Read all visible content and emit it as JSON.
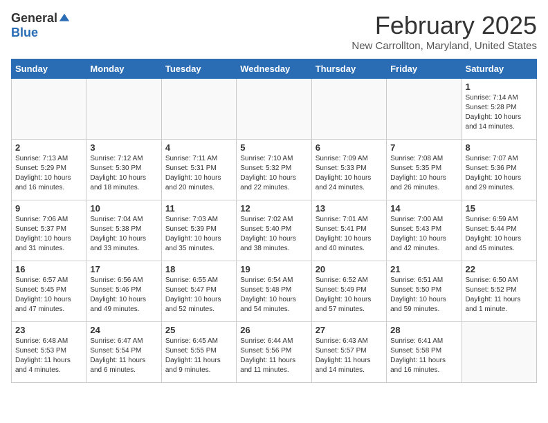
{
  "header": {
    "logo_general": "General",
    "logo_blue": "Blue",
    "month_title": "February 2025",
    "location": "New Carrollton, Maryland, United States"
  },
  "days_of_week": [
    "Sunday",
    "Monday",
    "Tuesday",
    "Wednesday",
    "Thursday",
    "Friday",
    "Saturday"
  ],
  "weeks": [
    [
      {
        "day": "",
        "info": ""
      },
      {
        "day": "",
        "info": ""
      },
      {
        "day": "",
        "info": ""
      },
      {
        "day": "",
        "info": ""
      },
      {
        "day": "",
        "info": ""
      },
      {
        "day": "",
        "info": ""
      },
      {
        "day": "1",
        "info": "Sunrise: 7:14 AM\nSunset: 5:28 PM\nDaylight: 10 hours and 14 minutes."
      }
    ],
    [
      {
        "day": "2",
        "info": "Sunrise: 7:13 AM\nSunset: 5:29 PM\nDaylight: 10 hours and 16 minutes."
      },
      {
        "day": "3",
        "info": "Sunrise: 7:12 AM\nSunset: 5:30 PM\nDaylight: 10 hours and 18 minutes."
      },
      {
        "day": "4",
        "info": "Sunrise: 7:11 AM\nSunset: 5:31 PM\nDaylight: 10 hours and 20 minutes."
      },
      {
        "day": "5",
        "info": "Sunrise: 7:10 AM\nSunset: 5:32 PM\nDaylight: 10 hours and 22 minutes."
      },
      {
        "day": "6",
        "info": "Sunrise: 7:09 AM\nSunset: 5:33 PM\nDaylight: 10 hours and 24 minutes."
      },
      {
        "day": "7",
        "info": "Sunrise: 7:08 AM\nSunset: 5:35 PM\nDaylight: 10 hours and 26 minutes."
      },
      {
        "day": "8",
        "info": "Sunrise: 7:07 AM\nSunset: 5:36 PM\nDaylight: 10 hours and 29 minutes."
      }
    ],
    [
      {
        "day": "9",
        "info": "Sunrise: 7:06 AM\nSunset: 5:37 PM\nDaylight: 10 hours and 31 minutes."
      },
      {
        "day": "10",
        "info": "Sunrise: 7:04 AM\nSunset: 5:38 PM\nDaylight: 10 hours and 33 minutes."
      },
      {
        "day": "11",
        "info": "Sunrise: 7:03 AM\nSunset: 5:39 PM\nDaylight: 10 hours and 35 minutes."
      },
      {
        "day": "12",
        "info": "Sunrise: 7:02 AM\nSunset: 5:40 PM\nDaylight: 10 hours and 38 minutes."
      },
      {
        "day": "13",
        "info": "Sunrise: 7:01 AM\nSunset: 5:41 PM\nDaylight: 10 hours and 40 minutes."
      },
      {
        "day": "14",
        "info": "Sunrise: 7:00 AM\nSunset: 5:43 PM\nDaylight: 10 hours and 42 minutes."
      },
      {
        "day": "15",
        "info": "Sunrise: 6:59 AM\nSunset: 5:44 PM\nDaylight: 10 hours and 45 minutes."
      }
    ],
    [
      {
        "day": "16",
        "info": "Sunrise: 6:57 AM\nSunset: 5:45 PM\nDaylight: 10 hours and 47 minutes."
      },
      {
        "day": "17",
        "info": "Sunrise: 6:56 AM\nSunset: 5:46 PM\nDaylight: 10 hours and 49 minutes."
      },
      {
        "day": "18",
        "info": "Sunrise: 6:55 AM\nSunset: 5:47 PM\nDaylight: 10 hours and 52 minutes."
      },
      {
        "day": "19",
        "info": "Sunrise: 6:54 AM\nSunset: 5:48 PM\nDaylight: 10 hours and 54 minutes."
      },
      {
        "day": "20",
        "info": "Sunrise: 6:52 AM\nSunset: 5:49 PM\nDaylight: 10 hours and 57 minutes."
      },
      {
        "day": "21",
        "info": "Sunrise: 6:51 AM\nSunset: 5:50 PM\nDaylight: 10 hours and 59 minutes."
      },
      {
        "day": "22",
        "info": "Sunrise: 6:50 AM\nSunset: 5:52 PM\nDaylight: 11 hours and 1 minute."
      }
    ],
    [
      {
        "day": "23",
        "info": "Sunrise: 6:48 AM\nSunset: 5:53 PM\nDaylight: 11 hours and 4 minutes."
      },
      {
        "day": "24",
        "info": "Sunrise: 6:47 AM\nSunset: 5:54 PM\nDaylight: 11 hours and 6 minutes."
      },
      {
        "day": "25",
        "info": "Sunrise: 6:45 AM\nSunset: 5:55 PM\nDaylight: 11 hours and 9 minutes."
      },
      {
        "day": "26",
        "info": "Sunrise: 6:44 AM\nSunset: 5:56 PM\nDaylight: 11 hours and 11 minutes."
      },
      {
        "day": "27",
        "info": "Sunrise: 6:43 AM\nSunset: 5:57 PM\nDaylight: 11 hours and 14 minutes."
      },
      {
        "day": "28",
        "info": "Sunrise: 6:41 AM\nSunset: 5:58 PM\nDaylight: 11 hours and 16 minutes."
      },
      {
        "day": "",
        "info": ""
      }
    ]
  ]
}
